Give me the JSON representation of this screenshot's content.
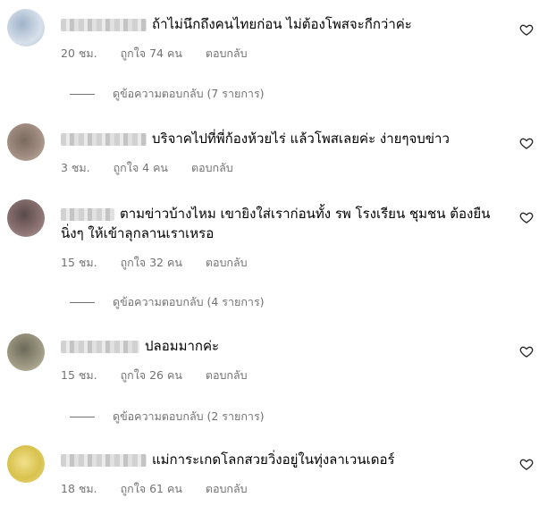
{
  "comments": [
    {
      "text": "ถ้าไม่นึกถึงคนไทยก่อน ไม่ต้องโพสจะกีกว่าค่ะ",
      "time": "20 ชม.",
      "likes": "ถูกใจ 74 คน",
      "reply": "ตอบกลับ",
      "view_replies": "ดูข้อความตอบกลับ (7 รายการ)"
    },
    {
      "text": "บริจาคไปที่พี่ก้องห้วยไร่ แล้วโพสเลยค่ะ ง่ายๆจบข่าว",
      "time": "3 ชม.",
      "likes": "ถูกใจ 4 คน",
      "reply": "ตอบกลับ"
    },
    {
      "text": "ตามข่าวบ้างไหม เขายิงใส่เราก่อนทั้ง รพ โรงเรียน ชุมชน ต้องยืนนิ่งๆ ให้เข้าลุกลานเราเหรอ",
      "time": "15 ชม.",
      "likes": "ถูกใจ 32 คน",
      "reply": "ตอบกลับ",
      "view_replies": "ดูข้อความตอบกลับ (4 รายการ)"
    },
    {
      "text": "ปลอมมากค่ะ",
      "time": "15 ชม.",
      "likes": "ถูกใจ 26 คน",
      "reply": "ตอบกลับ",
      "view_replies": "ดูข้อความตอบกลับ (2 รายการ)"
    },
    {
      "text": "แม่การะเกดโลกสวยวิ่งอยู่ในทุ่งลาเวนเดอร์",
      "time": "18 ชม.",
      "likes": "ถูกใจ 61 คน",
      "reply": "ตอบกลับ"
    }
  ],
  "icons": {
    "like": "heart-outline-icon",
    "avatar": "blurred-avatar"
  }
}
